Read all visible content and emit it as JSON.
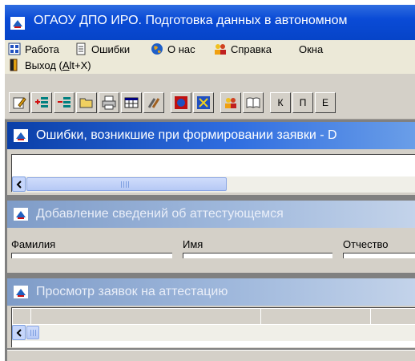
{
  "window": {
    "title": "ОГАОУ ДПО ИРО. Подготовка данных в автономном"
  },
  "menu": {
    "items": [
      {
        "label": "Работа",
        "icon": "grid-icon"
      },
      {
        "label": "Ошибки",
        "icon": "document-icon"
      },
      {
        "label": "О нас",
        "icon": "globe-icon"
      },
      {
        "label": "Справка",
        "icon": "people-icon"
      },
      {
        "label": "Окна",
        "icon": ""
      }
    ],
    "exit": {
      "label": "Выход (",
      "underlined": "A",
      "suffix": "lt+X)"
    }
  },
  "toolbar": {
    "letter_buttons": [
      "К",
      "П",
      "Е"
    ]
  },
  "windows": {
    "errors": {
      "title": "Ошибки, возникшие при формировании заявки - D",
      "active": true
    },
    "add_person": {
      "title": "Добавление сведений об аттестующемся",
      "fields": {
        "surname": "Фамилия",
        "name": "Имя",
        "patronymic": "Отчество"
      }
    },
    "view_requests": {
      "title": "Просмотр заявок на аттестацию"
    }
  },
  "colors": {
    "title_active": "#0a4bd6",
    "title_inactive": "#9fb8dc",
    "face": "#d4d0c8"
  }
}
